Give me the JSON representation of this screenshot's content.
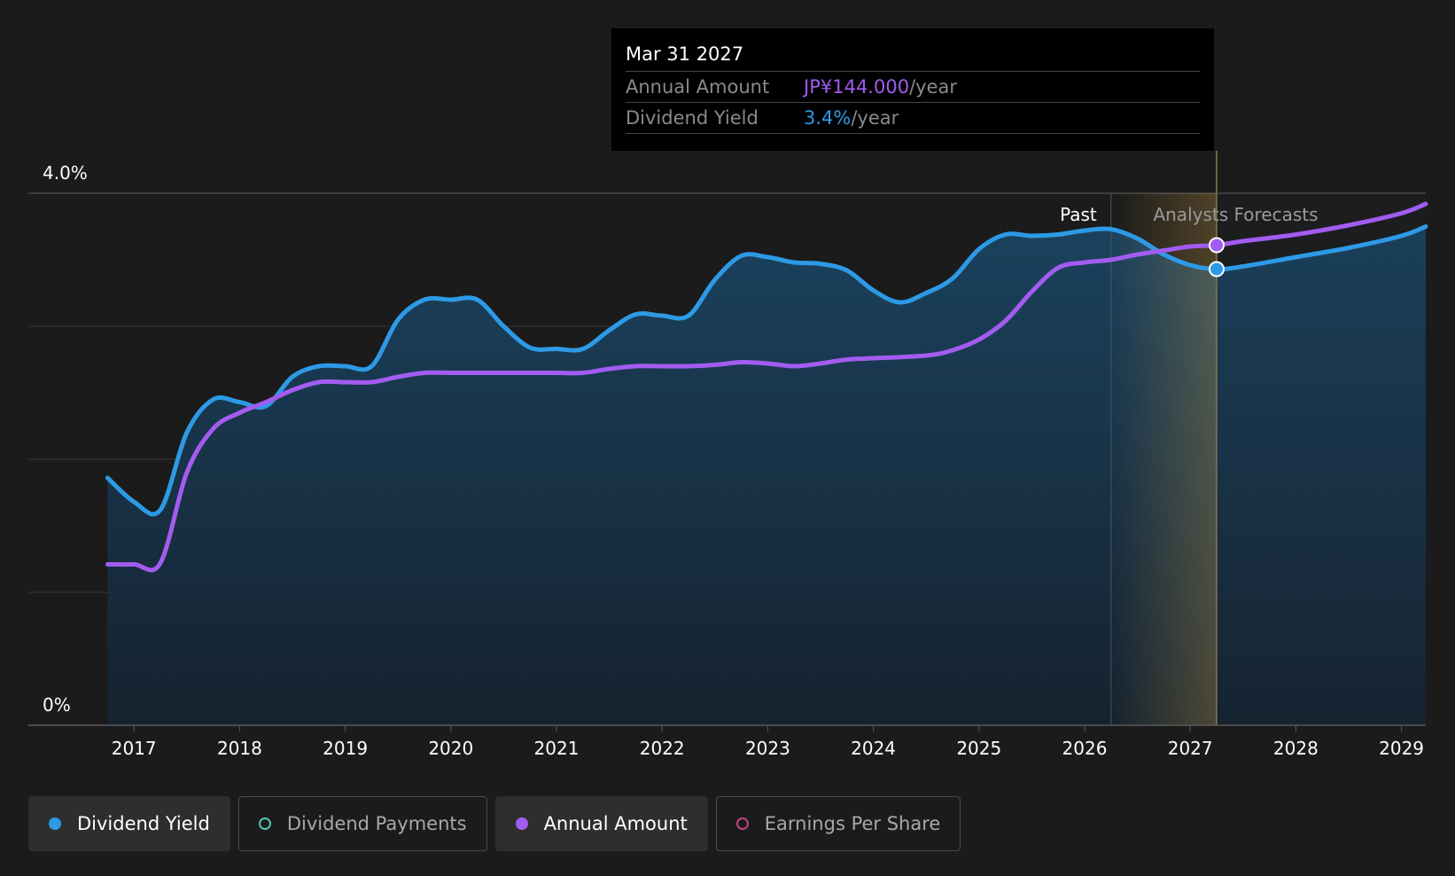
{
  "tooltip": {
    "date": "Mar 31 2027",
    "annual_label": "Annual Amount",
    "annual_value": "JP¥144.000",
    "annual_unit": "/year",
    "yield_label": "Dividend Yield",
    "yield_value": "3.4%",
    "yield_unit": "/year"
  },
  "legend": [
    {
      "label": "Dividend Yield",
      "color": "#2d9ae6",
      "active": true,
      "marker": "filled"
    },
    {
      "label": "Dividend Payments",
      "color": "#52c7b8",
      "active": false,
      "marker": "ring"
    },
    {
      "label": "Annual Amount",
      "color": "#a25cf0",
      "active": true,
      "marker": "filled"
    },
    {
      "label": "Earnings Per Share",
      "color": "#c0467f",
      "active": false,
      "marker": "ring"
    }
  ],
  "chart_data": {
    "type": "line",
    "ylim": [
      0,
      4.0
    ],
    "xlim": [
      2016.0,
      2029.23
    ],
    "y_tick_labels": [
      {
        "value": 4.0,
        "label": "4.0%"
      },
      {
        "value": 0,
        "label": "0%"
      }
    ],
    "gridlines": [
      1.0,
      2.0,
      3.0
    ],
    "x_ticks": [
      2017,
      2018,
      2019,
      2020,
      2021,
      2022,
      2023,
      2024,
      2025,
      2026,
      2027,
      2028,
      2029
    ],
    "past_label": "Past",
    "forecast_label": "Analysts Forecasts",
    "past_end": 2026.25,
    "hover_x": 2027.25,
    "series": [
      {
        "name": "Dividend Yield",
        "color": "#2d9ae6",
        "fill": true,
        "points": [
          [
            2016.75,
            1.86
          ],
          [
            2017.0,
            1.68
          ],
          [
            2017.25,
            1.62
          ],
          [
            2017.5,
            2.2
          ],
          [
            2017.75,
            2.45
          ],
          [
            2018.0,
            2.43
          ],
          [
            2018.25,
            2.4
          ],
          [
            2018.5,
            2.62
          ],
          [
            2018.75,
            2.7
          ],
          [
            2019.0,
            2.7
          ],
          [
            2019.25,
            2.7
          ],
          [
            2019.5,
            3.05
          ],
          [
            2019.75,
            3.2
          ],
          [
            2020.0,
            3.2
          ],
          [
            2020.25,
            3.2
          ],
          [
            2020.5,
            3.0
          ],
          [
            2020.75,
            2.84
          ],
          [
            2021.0,
            2.83
          ],
          [
            2021.25,
            2.83
          ],
          [
            2021.5,
            2.97
          ],
          [
            2021.75,
            3.09
          ],
          [
            2022.0,
            3.08
          ],
          [
            2022.25,
            3.08
          ],
          [
            2022.5,
            3.35
          ],
          [
            2022.75,
            3.53
          ],
          [
            2023.0,
            3.52
          ],
          [
            2023.25,
            3.48
          ],
          [
            2023.5,
            3.47
          ],
          [
            2023.75,
            3.42
          ],
          [
            2024.0,
            3.27
          ],
          [
            2024.25,
            3.18
          ],
          [
            2024.5,
            3.25
          ],
          [
            2024.75,
            3.36
          ],
          [
            2025.0,
            3.58
          ],
          [
            2025.25,
            3.69
          ],
          [
            2025.5,
            3.68
          ],
          [
            2025.75,
            3.69
          ],
          [
            2026.0,
            3.72
          ],
          [
            2026.25,
            3.73
          ],
          [
            2026.5,
            3.66
          ],
          [
            2026.75,
            3.54
          ],
          [
            2027.0,
            3.46
          ],
          [
            2027.25,
            3.43
          ],
          [
            2027.5,
            3.45
          ],
          [
            2028.0,
            3.52
          ],
          [
            2028.5,
            3.59
          ],
          [
            2029.0,
            3.68
          ],
          [
            2029.23,
            3.75
          ]
        ]
      },
      {
        "name": "Annual Amount",
        "color": "#a25cf0",
        "fill": false,
        "points": [
          [
            2016.75,
            1.21
          ],
          [
            2017.0,
            1.21
          ],
          [
            2017.25,
            1.22
          ],
          [
            2017.5,
            1.9
          ],
          [
            2017.75,
            2.23
          ],
          [
            2018.0,
            2.35
          ],
          [
            2018.25,
            2.43
          ],
          [
            2018.5,
            2.52
          ],
          [
            2018.75,
            2.58
          ],
          [
            2019.0,
            2.58
          ],
          [
            2019.25,
            2.58
          ],
          [
            2019.5,
            2.62
          ],
          [
            2019.75,
            2.65
          ],
          [
            2020.0,
            2.65
          ],
          [
            2020.5,
            2.65
          ],
          [
            2021.0,
            2.65
          ],
          [
            2021.25,
            2.65
          ],
          [
            2021.5,
            2.68
          ],
          [
            2021.75,
            2.7
          ],
          [
            2022.0,
            2.7
          ],
          [
            2022.25,
            2.7
          ],
          [
            2022.5,
            2.71
          ],
          [
            2022.75,
            2.73
          ],
          [
            2023.0,
            2.72
          ],
          [
            2023.25,
            2.7
          ],
          [
            2023.5,
            2.72
          ],
          [
            2023.75,
            2.75
          ],
          [
            2024.0,
            2.76
          ],
          [
            2024.5,
            2.78
          ],
          [
            2024.75,
            2.82
          ],
          [
            2025.0,
            2.9
          ],
          [
            2025.25,
            3.04
          ],
          [
            2025.5,
            3.26
          ],
          [
            2025.75,
            3.44
          ],
          [
            2026.0,
            3.48
          ],
          [
            2026.25,
            3.5
          ],
          [
            2026.5,
            3.54
          ],
          [
            2026.75,
            3.57
          ],
          [
            2027.0,
            3.6
          ],
          [
            2027.25,
            3.61
          ],
          [
            2027.5,
            3.64
          ],
          [
            2028.0,
            3.69
          ],
          [
            2028.5,
            3.76
          ],
          [
            2029.0,
            3.85
          ],
          [
            2029.23,
            3.92
          ]
        ]
      }
    ],
    "hover_points": [
      {
        "series": "Annual Amount",
        "x": 2027.25,
        "y": 3.61
      },
      {
        "series": "Dividend Yield",
        "x": 2027.25,
        "y": 3.43
      }
    ]
  }
}
